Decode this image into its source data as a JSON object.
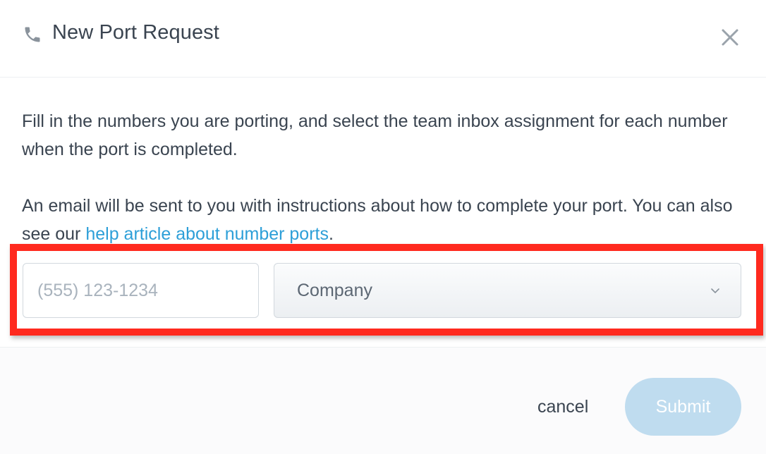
{
  "header": {
    "icon": "phone-icon",
    "title": "New Port Request",
    "close_icon": "close-icon"
  },
  "body": {
    "paragraph1": "Fill in the numbers you are porting, and select the team inbox assignment for each number when the port is completed.",
    "paragraph2_prefix": "An email will be sent to you with instructions about how to complete your port. You can also see our ",
    "help_link": "help article about number ports",
    "paragraph2_suffix": "."
  },
  "form": {
    "phone_placeholder": "(555) 123-1234",
    "phone_value": "",
    "company_selected": "Company",
    "company_icon": "chevron-down-icon"
  },
  "footer": {
    "cancel_label": "cancel",
    "submit_label": "Submit",
    "submit_disabled": true
  },
  "colors": {
    "link": "#2d9fd8",
    "highlight": "#ff2a1f",
    "submit_disabled_bg": "#bfdcef",
    "text": "#3a4450"
  }
}
